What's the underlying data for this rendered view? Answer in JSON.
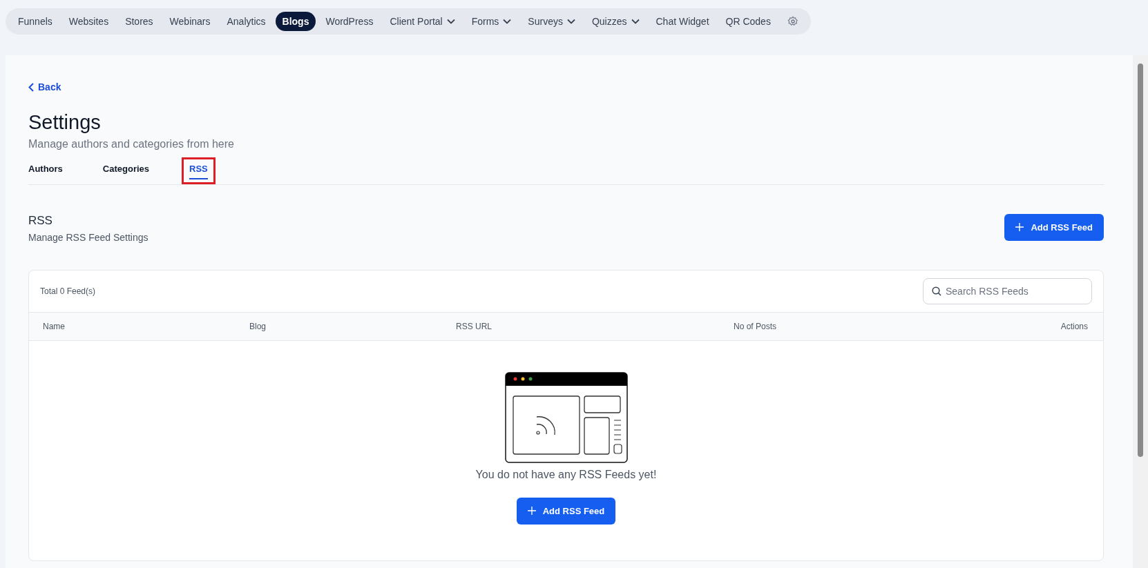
{
  "nav": {
    "items": [
      {
        "label": "Funnels",
        "selected": false,
        "dropdown": false
      },
      {
        "label": "Websites",
        "selected": false,
        "dropdown": false
      },
      {
        "label": "Stores",
        "selected": false,
        "dropdown": false
      },
      {
        "label": "Webinars",
        "selected": false,
        "dropdown": false
      },
      {
        "label": "Analytics",
        "selected": false,
        "dropdown": false
      },
      {
        "label": "Blogs",
        "selected": true,
        "dropdown": false
      },
      {
        "label": "WordPress",
        "selected": false,
        "dropdown": false
      },
      {
        "label": "Client Portal",
        "selected": false,
        "dropdown": true
      },
      {
        "label": "Forms",
        "selected": false,
        "dropdown": true
      },
      {
        "label": "Surveys",
        "selected": false,
        "dropdown": true
      },
      {
        "label": "Quizzes",
        "selected": false,
        "dropdown": true
      },
      {
        "label": "Chat Widget",
        "selected": false,
        "dropdown": false
      },
      {
        "label": "QR Codes",
        "selected": false,
        "dropdown": false
      }
    ]
  },
  "back": "Back",
  "page": {
    "title": "Settings",
    "subtitle": "Manage authors and categories from here"
  },
  "tabs": [
    {
      "label": "Authors",
      "selected": false,
      "highlighted": false
    },
    {
      "label": "Categories",
      "selected": false,
      "highlighted": false
    },
    {
      "label": "RSS",
      "selected": true,
      "highlighted": true
    }
  ],
  "section": {
    "title": "RSS",
    "subtitle": "Manage RSS Feed Settings",
    "button": "Add RSS Feed"
  },
  "table": {
    "total": "Total 0 Feed(s)",
    "search": {
      "placeholder": "Search RSS Feeds"
    },
    "columns": [
      "Name",
      "Blog",
      "RSS URL",
      "No of Posts",
      "Actions"
    ],
    "empty": {
      "message": "You do not have any RSS Feeds yet!",
      "button": "Add RSS Feed"
    }
  }
}
